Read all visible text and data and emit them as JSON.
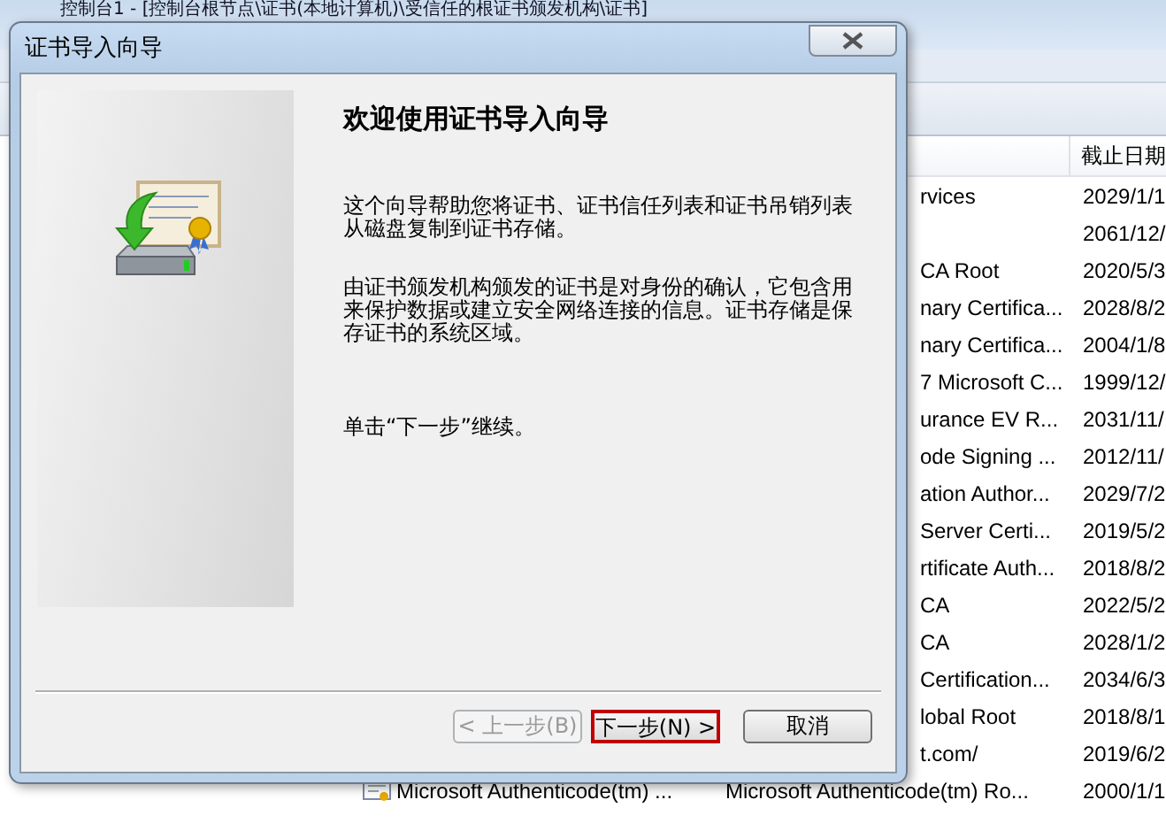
{
  "background_window": {
    "title": "控制台1 - [控制台根节点\\证书(本地计算机)\\受信任的根证书颁发机构\\证书]",
    "list": {
      "date_column": "截止日期",
      "rows": [
        {
          "kind": "covered",
          "issuer": "rvices",
          "date": "2029/1/1"
        },
        {
          "kind": "covered",
          "issuer": "",
          "date": "2061/12/"
        },
        {
          "kind": "covered",
          "issuer": "CA Root",
          "date": "2020/5/3"
        },
        {
          "kind": "covered",
          "issuer": "nary Certifica...",
          "date": "2028/8/2"
        },
        {
          "kind": "covered",
          "issuer": "nary Certifica...",
          "date": "2004/1/8"
        },
        {
          "kind": "covered",
          "issuer": "7 Microsoft C...",
          "date": "1999/12/"
        },
        {
          "kind": "covered",
          "issuer": "urance EV R...",
          "date": "2031/11/"
        },
        {
          "kind": "covered",
          "issuer": "ode Signing ...",
          "date": "2012/11/"
        },
        {
          "kind": "covered",
          "issuer": "ation Author...",
          "date": "2029/7/2"
        },
        {
          "kind": "covered",
          "issuer": "Server Certi...",
          "date": "2019/5/2"
        },
        {
          "kind": "covered",
          "issuer": "rtificate Auth...",
          "date": "2018/8/2"
        },
        {
          "kind": "covered",
          "issuer": "CA",
          "date": "2022/5/2"
        },
        {
          "kind": "covered",
          "issuer": "CA",
          "date": "2028/1/2"
        },
        {
          "kind": "covered",
          "issuer": "Certification...",
          "date": "2034/6/3"
        },
        {
          "kind": "covered",
          "issuer": "lobal Root",
          "date": "2018/8/1"
        },
        {
          "kind": "covered",
          "issuer": "t.com/",
          "date": "2019/6/2"
        },
        {
          "kind": "full",
          "name": "Microsoft Authenticode(tm) ...",
          "issuer": "Microsoft Authenticode(tm) Ro...",
          "date": "2000/1/1"
        }
      ]
    }
  },
  "dialog": {
    "title": "证书导入向导",
    "heading": "欢迎使用证书导入向导",
    "paragraphs": [
      "这个向导帮助您将证书、证书信任列表和证书吊销列表从磁盘复制到证书存储。",
      "由证书颁发机构颁发的证书是对身份的确认，它包含用来保护数据或建立安全网络连接的信息。证书存储是保存证书的系统区域。",
      "单击“下一步”继续。"
    ],
    "buttons": [
      {
        "label": "< 上一步(B)",
        "disabled": true,
        "highlighted": false
      },
      {
        "label": "下一步(N) >",
        "disabled": false,
        "highlighted": true
      },
      {
        "label": "取消",
        "disabled": false,
        "highlighted": false
      }
    ]
  }
}
